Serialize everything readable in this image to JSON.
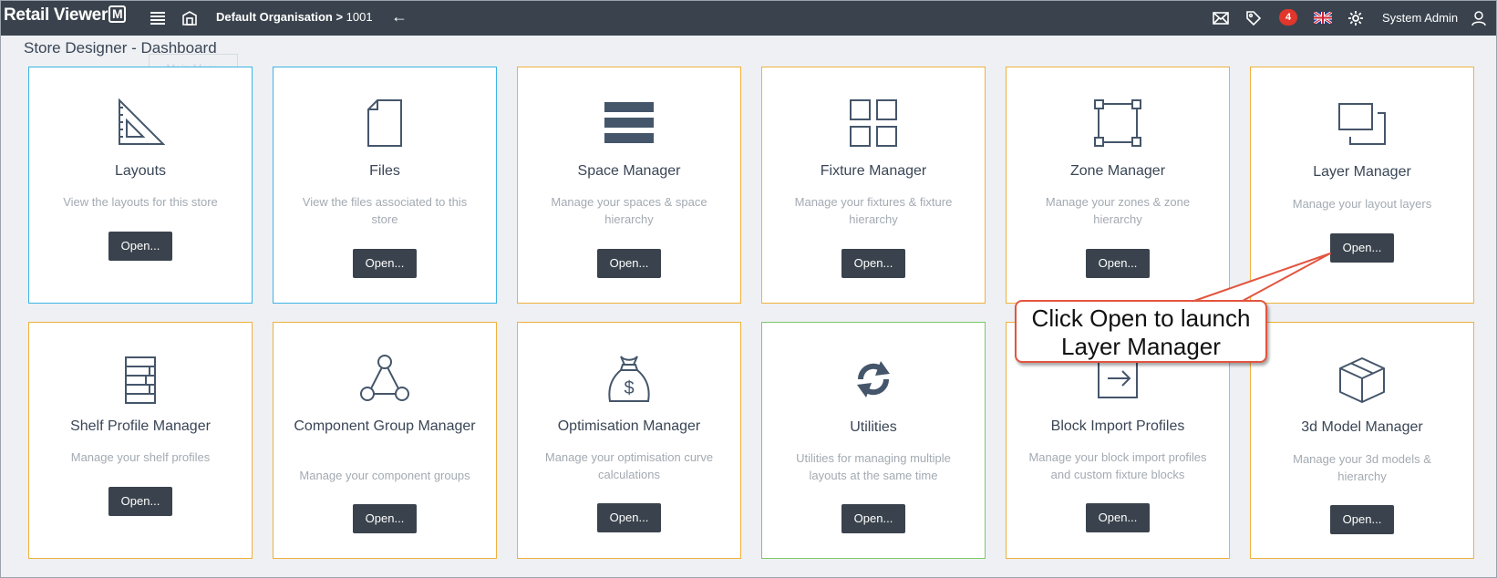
{
  "topbar": {
    "logo_text": "Retail Viewer",
    "logo_badge": "M",
    "breadcrumb": "Default Organisation > ",
    "store_number": "1001",
    "notification_count": "4",
    "user_name": "System Admin"
  },
  "page": {
    "title": "Store Designer - Dashboard",
    "ghost_label": "Main Menu"
  },
  "open_label": "Open...",
  "cards": [
    {
      "title": "Layouts",
      "desc": "View the layouts for this store"
    },
    {
      "title": "Files",
      "desc": "View the files associated to this store"
    },
    {
      "title": "Space Manager",
      "desc": "Manage your spaces & space hierarchy"
    },
    {
      "title": "Fixture Manager",
      "desc": "Manage your fixtures & fixture hierarchy"
    },
    {
      "title": "Zone Manager",
      "desc": "Manage your zones & zone hierarchy"
    },
    {
      "title": "Layer Manager",
      "desc": "Manage your layout layers"
    },
    {
      "title": "Shelf Profile Manager",
      "desc": "Manage your shelf profiles"
    },
    {
      "title": "Component Group Manager",
      "desc": "Manage your component groups"
    },
    {
      "title": "Optimisation Manager",
      "desc": "Manage your optimisation curve calculations"
    },
    {
      "title": "Utilities",
      "desc": "Utilities for managing multiple layouts at the same time"
    },
    {
      "title": "Block Import Profiles",
      "desc": "Manage your block import profiles and custom fixture blocks"
    },
    {
      "title": "3d Model Manager",
      "desc": "Manage your 3d models & hierarchy"
    }
  ],
  "callout": {
    "line1": "Click Open to launch",
    "line2": "Layer Manager"
  },
  "colors": {
    "topbar": "#3a434d",
    "card_border_orange": "#f0b13c",
    "card_border_blue": "#3cb4e5",
    "card_border_green": "#7cc86a",
    "badge": "#e0362c",
    "callout_border": "#e2553f"
  },
  "icons": [
    "layout-icon",
    "file-icon",
    "space-manager-icon",
    "fixture-grid-icon",
    "zone-icon",
    "layers-icon",
    "shelf-profile-icon",
    "component-group-icon",
    "money-bag-icon",
    "refresh-icon",
    "import-icon",
    "cube-icon"
  ]
}
